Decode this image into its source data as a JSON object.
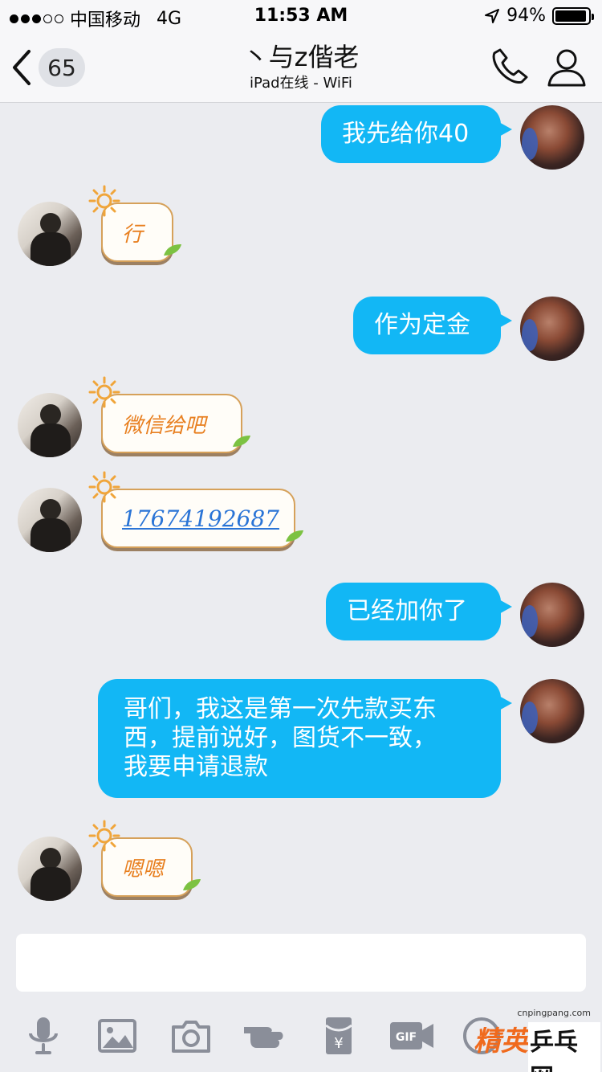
{
  "status_bar": {
    "carrier": "中国移动",
    "network": "4G",
    "time": "11:53 AM",
    "battery": "94%",
    "battery_level": 0.94,
    "signal_dots": [
      true,
      true,
      true,
      false,
      false
    ]
  },
  "nav": {
    "unread_count": "65",
    "title": "丶与z偕老",
    "subtitle": "iPad在线 - WiFi"
  },
  "messages": [
    {
      "from": "me",
      "text": "我先给你40"
    },
    {
      "from": "them",
      "text": "行"
    },
    {
      "from": "me",
      "text": "作为定金"
    },
    {
      "from": "them",
      "text": "微信给吧"
    },
    {
      "from": "them",
      "text": "17674192687"
    },
    {
      "from": "me",
      "text": "已经加你了"
    },
    {
      "from": "me",
      "lines": [
        "哥们，我这是第一次先款买东",
        "西，提前说好，图货不一致，",
        "我要申请退款"
      ]
    },
    {
      "from": "them",
      "text": "嗯嗯"
    }
  ],
  "input": {
    "placeholder": ""
  },
  "toolbar": {
    "icons": [
      "microphone-icon",
      "image-icon",
      "camera-icon",
      "poke-icon",
      "red-packet-icon",
      "gif-icon",
      "emoji-icon"
    ],
    "red_packet_symbol": "¥",
    "gif_label": "GIF"
  },
  "watermark": {
    "url": "cnpingpang.com",
    "brand_a": "精英",
    "brand_b": "乒乓网"
  },
  "colors": {
    "accent": "#12b7f5",
    "background": "#ebecf0",
    "sun_text": "#e87f1f",
    "link": "#2a74d6"
  }
}
